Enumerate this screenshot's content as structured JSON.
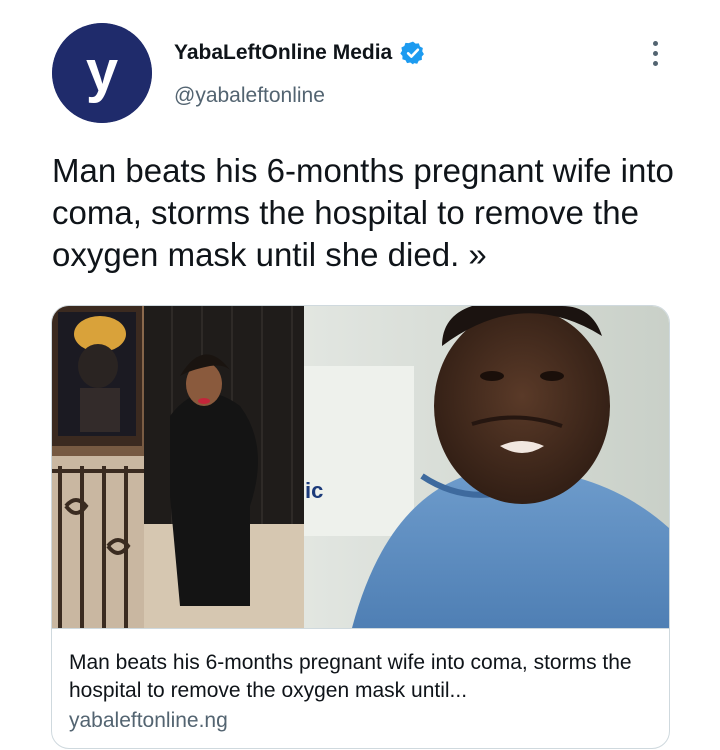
{
  "author": {
    "display_name": "YabaLeftOnline Media",
    "handle": "@yabaleftonline",
    "avatar_letter": "y",
    "avatar_color": "#1f2b6b",
    "verified": true,
    "verified_icon": "verified-badge-icon",
    "verified_color": "#1d9bf0"
  },
  "menu": {
    "icon": "more-vertical-icon"
  },
  "tweet": {
    "text": "Man beats his 6-months pregnant wife into coma, storms the hospital to remove the oxygen mask until she died. »"
  },
  "link_card": {
    "image_sign_text": "ic",
    "title": "Man beats his 6-months pregnant wife into coma, storms the hospital to remove the oxygen mask until...",
    "domain": "yabaleftonline.ng"
  },
  "colors": {
    "text_primary": "#0f1419",
    "text_secondary": "#536471",
    "border": "#cfd9de"
  }
}
